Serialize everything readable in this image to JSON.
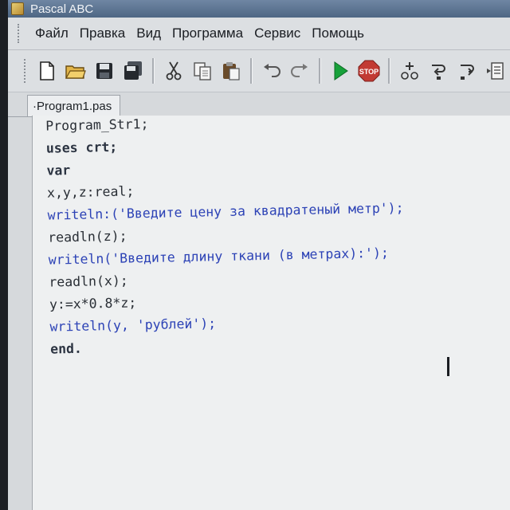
{
  "window": {
    "title": "Pascal ABC"
  },
  "menu": {
    "items": [
      "Файл",
      "Правка",
      "Вид",
      "Программа",
      "Сервис",
      "Помощь"
    ]
  },
  "toolbar": {
    "icons": [
      "new-file-icon",
      "open-folder-icon",
      "save-icon",
      "save-all-icon",
      "cut-icon",
      "copy-icon",
      "paste-icon",
      "undo-icon",
      "redo-icon",
      "run-icon",
      "stop-icon",
      "step-over-icon",
      "step-into-icon",
      "step-out-icon",
      "watch-icon"
    ],
    "stop_label": "STOP"
  },
  "tabs": [
    {
      "label": "·Program1.pas",
      "active": true
    }
  ],
  "editor": {
    "lines": [
      "Program_Str1;",
      "uses crt;",
      "var",
      "x,y,z:real;",
      "writeln:('Введите цену за квадратеный метр');",
      "readln(z);",
      "writeln('Введите длину ткани (в метрах):');",
      "readln(x);",
      "y:=x*0.8*z;",
      "writeln(y, 'рублей');",
      "end."
    ]
  },
  "colors": {
    "titlebar": "#5b7391",
    "editor_bg": "#eef0f1",
    "string": "#2d43b6",
    "run_green": "#17a13a",
    "stop_red": "#c23a33"
  }
}
